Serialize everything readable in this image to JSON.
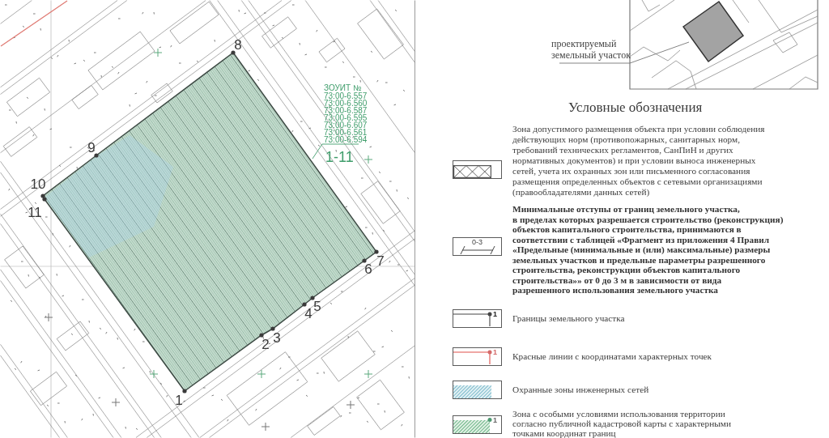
{
  "map": {
    "boundary_points": [
      {
        "label": "1"
      },
      {
        "label": "2"
      },
      {
        "label": "3"
      },
      {
        "label": "4"
      },
      {
        "label": "5"
      },
      {
        "label": "6"
      },
      {
        "label": "7"
      },
      {
        "label": "8"
      },
      {
        "label": "9"
      },
      {
        "label": "10"
      },
      {
        "label": "11"
      }
    ],
    "zone_registry": {
      "title": "ЗОУИТ №",
      "codes": [
        "73:00-6.557",
        "73:00-6.560",
        "73:00-6.587",
        "73:00-6.595",
        "73:00-6.607",
        "73:00-6.561",
        "73:00-6.594"
      ]
    },
    "zone_label": "1-11"
  },
  "inset": {
    "caption_lines": [
      "проектируемый",
      "земельный участок"
    ]
  },
  "legend": {
    "title": "Условные обозначения",
    "items": [
      {
        "kind": "permitted_zone",
        "lines": [
          "Зона допустимого размещения объекта при условии соблюдения",
          "действующих норм (противопожарных, санитарных норм,",
          "требований технических регламентов, СанПиН и других",
          "нормативных документов) и при условии выноса инженерных",
          "сетей, учета их охранных зон или письменного согласования",
          "размещения определенных объектов с сетевыми организациями",
          "(правообладателями данных сетей)"
        ]
      },
      {
        "kind": "setback",
        "symbol_label": "0-3",
        "lines": [
          "Минимальные отступы от границ земельного участка,",
          "в пределах которых разрешается строительство (реконструкция)",
          "объектов капитального строительства, принимаются в",
          "соответствии с таблицей «Фрагмент из приложения 4 Правил",
          "«Предельные (минимальные и (или) максимальные) размеры",
          "земельных участков и предельные параметры разрешенного",
          "строительства, реконструкции объектов капитального",
          "строительства»» от 0 до 3 м в зависимости от вида",
          "разрешенного использования земельного участка"
        ]
      },
      {
        "kind": "boundary",
        "symbol_label": "1",
        "lines": [
          "Границы земельного участка"
        ]
      },
      {
        "kind": "red_line",
        "symbol_label": "1",
        "lines": [
          "Красные линии с координатами характерных точек"
        ]
      },
      {
        "kind": "protection_zone",
        "lines": [
          "Охранные зоны инженерных сетей"
        ]
      },
      {
        "kind": "special_zone",
        "symbol_label": "1",
        "lines": [
          "Зона с особыми условиями использования территории",
          "согласно публичной кадастровой карты с характерными",
          "точками координат границ"
        ]
      }
    ]
  }
}
